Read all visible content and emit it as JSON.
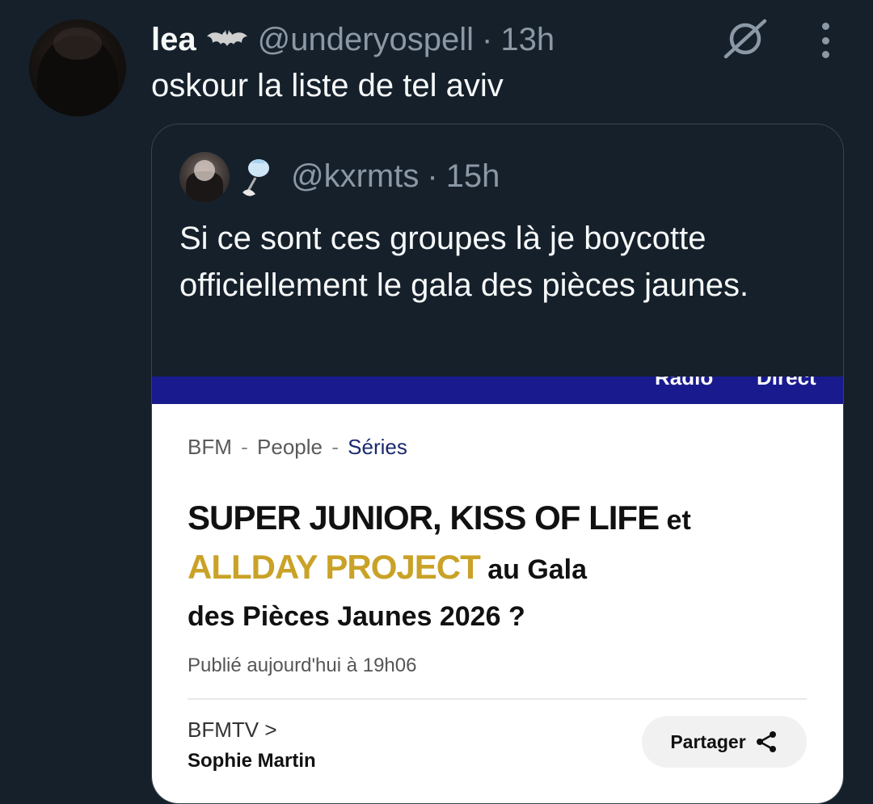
{
  "tweet": {
    "name": "lea",
    "handle": "@underyospell",
    "separator": "·",
    "time": "13h",
    "text": "oskour la liste de tel aviv"
  },
  "quote": {
    "handle": "@kxrmts",
    "separator": "·",
    "time": "15h",
    "text": "Si ce sont ces groupes là je boycotte officiellement le gala des pièces jaunes."
  },
  "article": {
    "navbar": {
      "item_1": "Radio",
      "item_2": "Direct",
      "color": "#1a1a8f"
    },
    "breadcrumb": {
      "part_1": "BFM",
      "sep": "-",
      "part_2": "People",
      "part_3": "Séries"
    },
    "headline": {
      "line1_bold": "SUPER JUNIOR, KISS OF LIFE",
      "line1_end": " et",
      "line2_gold": "ALLDAY PROJECT",
      "line2_end": " au Gala",
      "line3": "des Pièces Jaunes 2026 ?",
      "gold_color": "#c9a227"
    },
    "published": "Publié aujourd'hui à 19h06",
    "source": "BFMTV >",
    "author": "Sophie Martin",
    "share_label": "Partager"
  }
}
